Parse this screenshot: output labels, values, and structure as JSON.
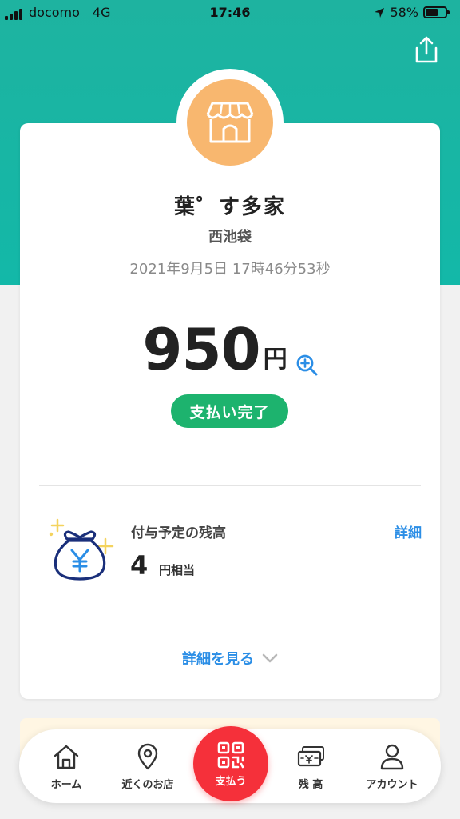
{
  "status_bar": {
    "carrier": "docomo",
    "network": "4G",
    "time": "17:46",
    "battery": "58%"
  },
  "receipt": {
    "store_name": "葉゜す多家",
    "branch": "西池袋",
    "datetime": "2021年9月5日 17時46分53秒",
    "amount": "950",
    "currency": "円",
    "status_badge": "支払い完了"
  },
  "points": {
    "title": "付与予定の残高",
    "detail_link": "詳細",
    "value": "4",
    "unit": "円相当"
  },
  "see_details": "詳細を見る",
  "bottom_nav": {
    "items": [
      {
        "label": "ホーム",
        "icon": "home-icon"
      },
      {
        "label": "近くのお店",
        "icon": "location-pin-icon"
      },
      {
        "label": "支払う",
        "icon": "qr-code-icon"
      },
      {
        "label": "残 高",
        "icon": "wallet-icon"
      },
      {
        "label": "アカウント",
        "icon": "person-icon"
      }
    ]
  },
  "colors": {
    "header_teal": "#1eb3a0",
    "store_icon_bg": "#f8b76f",
    "success_green": "#1db36e",
    "link_blue": "#2b8ee6",
    "pay_red": "#f5303a"
  }
}
